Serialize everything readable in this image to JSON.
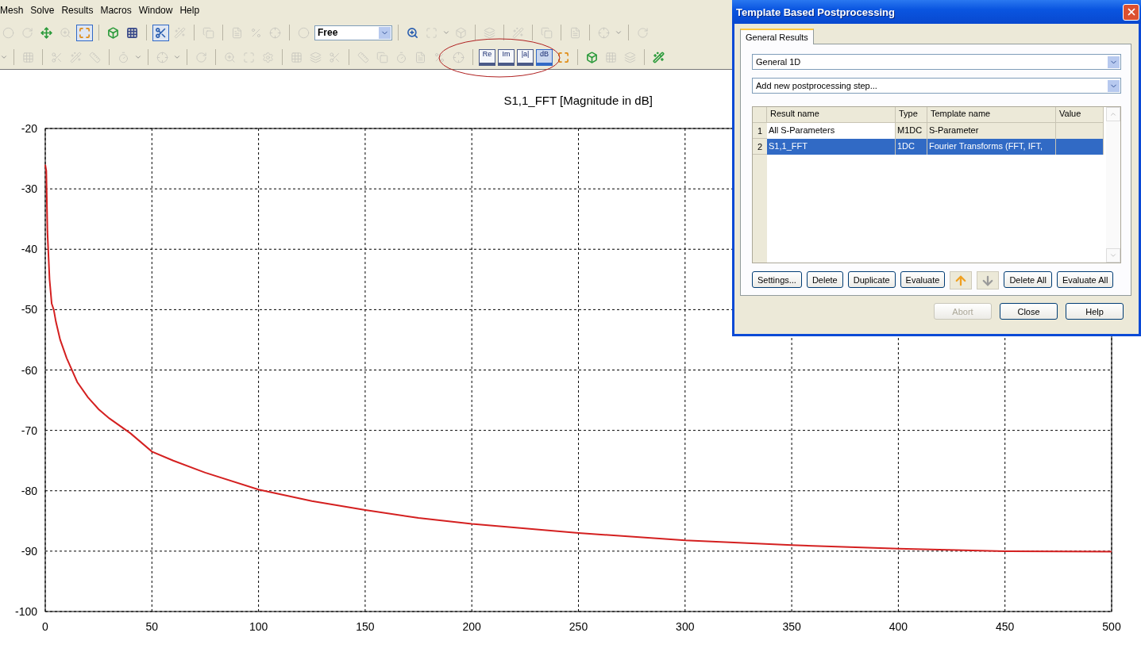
{
  "menu": [
    {
      "label": "Mesh"
    },
    {
      "label": "Solve"
    },
    {
      "label": "Results"
    },
    {
      "label": "Macros"
    },
    {
      "label": "Window"
    },
    {
      "label": "Help"
    }
  ],
  "toolbars": [
    {
      "items": [
        {
          "kind": "button",
          "disabled": true,
          "pressed": false
        },
        {
          "kind": "button",
          "disabled": true,
          "pressed": false
        },
        {
          "kind": "button",
          "disabled": false,
          "pressed": false
        },
        {
          "kind": "button",
          "disabled": true,
          "pressed": false
        },
        {
          "kind": "button",
          "disabled": false,
          "pressed": true
        },
        {
          "kind": "separator"
        },
        {
          "kind": "button",
          "disabled": false,
          "pressed": false
        },
        {
          "kind": "button",
          "disabled": false,
          "pressed": false
        },
        {
          "kind": "separator"
        },
        {
          "kind": "button",
          "disabled": false,
          "pressed": true
        },
        {
          "kind": "button",
          "disabled": true,
          "pressed": false
        },
        {
          "kind": "separator"
        },
        {
          "kind": "button",
          "disabled": true,
          "pressed": false
        },
        {
          "kind": "separator"
        },
        {
          "kind": "button",
          "disabled": true,
          "pressed": false
        },
        {
          "kind": "button",
          "disabled": true,
          "pressed": false
        },
        {
          "kind": "button",
          "disabled": true,
          "pressed": false
        },
        {
          "kind": "separator"
        },
        {
          "kind": "button",
          "disabled": true,
          "pressed": false
        },
        {
          "kind": "combo",
          "value": "Free"
        },
        {
          "kind": "separator"
        },
        {
          "kind": "button",
          "disabled": false,
          "pressed": false
        },
        {
          "kind": "button",
          "disabled": true,
          "pressed": false
        },
        {
          "kind": "caret"
        },
        {
          "kind": "button",
          "disabled": true,
          "pressed": false
        },
        {
          "kind": "separator"
        },
        {
          "kind": "button",
          "disabled": true,
          "pressed": false
        },
        {
          "kind": "separator"
        },
        {
          "kind": "button",
          "disabled": true,
          "pressed": false
        },
        {
          "kind": "separator"
        },
        {
          "kind": "button",
          "disabled": true,
          "pressed": false
        },
        {
          "kind": "separator"
        },
        {
          "kind": "button",
          "disabled": true,
          "pressed": false
        },
        {
          "kind": "separator"
        },
        {
          "kind": "button",
          "disabled": true,
          "pressed": false
        },
        {
          "kind": "caret"
        },
        {
          "kind": "separator"
        },
        {
          "kind": "button",
          "disabled": true,
          "pressed": false
        }
      ]
    },
    {
      "items": [
        {
          "kind": "caret"
        },
        {
          "kind": "separator"
        },
        {
          "kind": "button",
          "disabled": true,
          "pressed": false
        },
        {
          "kind": "separator"
        },
        {
          "kind": "button",
          "disabled": true,
          "pressed": false
        },
        {
          "kind": "button",
          "disabled": true,
          "pressed": false
        },
        {
          "kind": "button",
          "disabled": true,
          "pressed": false
        },
        {
          "kind": "separator"
        },
        {
          "kind": "button",
          "disabled": true,
          "pressed": false
        },
        {
          "kind": "caret"
        },
        {
          "kind": "separator"
        },
        {
          "kind": "button",
          "disabled": true,
          "pressed": false
        },
        {
          "kind": "caret"
        },
        {
          "kind": "separator"
        },
        {
          "kind": "button",
          "disabled": true,
          "pressed": false
        },
        {
          "kind": "separator"
        },
        {
          "kind": "button",
          "disabled": true,
          "pressed": false
        },
        {
          "kind": "button",
          "disabled": true,
          "pressed": false
        },
        {
          "kind": "button",
          "disabled": true,
          "pressed": false
        },
        {
          "kind": "separator"
        },
        {
          "kind": "button",
          "disabled": true,
          "pressed": false
        },
        {
          "kind": "button",
          "disabled": true,
          "pressed": false
        },
        {
          "kind": "button",
          "disabled": true,
          "pressed": false
        },
        {
          "kind": "separator"
        },
        {
          "kind": "button",
          "disabled": true,
          "pressed": false
        },
        {
          "kind": "button",
          "disabled": true,
          "pressed": false
        },
        {
          "kind": "button",
          "disabled": true,
          "pressed": false
        },
        {
          "kind": "button",
          "disabled": true,
          "pressed": false
        },
        {
          "kind": "button",
          "disabled": true,
          "pressed": false
        },
        {
          "kind": "button",
          "disabled": true,
          "pressed": false
        },
        {
          "kind": "separator"
        },
        {
          "kind": "label",
          "label": "Re",
          "disabled": false,
          "pressed": false
        },
        {
          "kind": "label",
          "label": "Im",
          "disabled": false,
          "pressed": false
        },
        {
          "kind": "label",
          "label": "|a|",
          "disabled": false,
          "pressed": false
        },
        {
          "kind": "label",
          "label": "dB",
          "disabled": false,
          "pressed": true
        },
        {
          "kind": "button",
          "disabled": false,
          "pressed": false
        },
        {
          "kind": "separator"
        },
        {
          "kind": "button",
          "disabled": false,
          "pressed": false
        },
        {
          "kind": "button",
          "disabled": true,
          "pressed": false
        },
        {
          "kind": "button",
          "disabled": true,
          "pressed": false
        },
        {
          "kind": "separator"
        },
        {
          "kind": "button",
          "disabled": false,
          "pressed": false
        }
      ]
    }
  ],
  "annotation": {
    "kind": "ellipse"
  },
  "plot": {
    "chart_data": {
      "type": "line",
      "title": "S1,1_FFT [Magnitude in dB]",
      "x": [
        0,
        0.5,
        1,
        2,
        3,
        4,
        5,
        7,
        10,
        15,
        20,
        25,
        30,
        40,
        50,
        60,
        75,
        100,
        125,
        150,
        175,
        200,
        250,
        300,
        350,
        400,
        450,
        500
      ],
      "grid": true,
      "series": [
        {
          "color": "#d42020",
          "values": [
            -26,
            -27,
            -37,
            -45,
            -49,
            -50,
            -52,
            -55,
            -58,
            -62,
            -64.5,
            -66.5,
            -68,
            -70.5,
            -73.5,
            -75,
            -77,
            -79.8,
            -81.7,
            -83.2,
            -84.5,
            -85.5,
            -87,
            -88.2,
            -89,
            -89.6,
            -90,
            -90.1
          ]
        }
      ],
      "xlim": [
        0,
        500
      ],
      "ylim": [
        -100,
        -20
      ],
      "xticks": [
        0,
        50,
        100,
        150,
        200,
        250,
        300,
        350,
        400,
        450,
        500
      ],
      "yticks": [
        -100,
        -90,
        -80,
        -70,
        -60,
        -50,
        -40,
        -30,
        -20
      ]
    }
  },
  "dialog": {
    "title": "Template Based Postprocessing",
    "tabs": [
      {
        "label": "General Results",
        "selected": true
      }
    ],
    "category": {
      "value": "General 1D"
    },
    "step": {
      "value": "Add new postprocessing step..."
    },
    "table": {
      "columns": [
        "Result name",
        "Type",
        "Template name",
        "Value"
      ],
      "rows": [
        {
          "number": "1",
          "cells": [
            "All S-Parameters",
            "M1DC",
            "S-Parameter"
          ],
          "selected": false
        },
        {
          "number": "2",
          "cells": [
            "S1,1_FFT",
            "1DC",
            "Fourier Transforms (FFT, IFT,"
          ],
          "selected": true
        }
      ]
    },
    "actions": [
      {
        "kind": "text",
        "label": "Settings...",
        "disabled": false
      },
      {
        "kind": "text",
        "label": "Delete",
        "disabled": false
      },
      {
        "kind": "text",
        "label": "Duplicate",
        "disabled": false
      },
      {
        "kind": "text",
        "label": "Evaluate",
        "disabled": false
      },
      {
        "kind": "up",
        "disabled": false
      },
      {
        "kind": "down",
        "disabled": true
      },
      {
        "kind": "text",
        "label": "Delete All",
        "disabled": false
      },
      {
        "kind": "text",
        "label": "Evaluate All",
        "disabled": false
      }
    ],
    "footer": [
      {
        "label": "Abort",
        "disabled": true
      },
      {
        "label": "Close",
        "disabled": false
      },
      {
        "label": "Help",
        "disabled": false
      }
    ]
  }
}
